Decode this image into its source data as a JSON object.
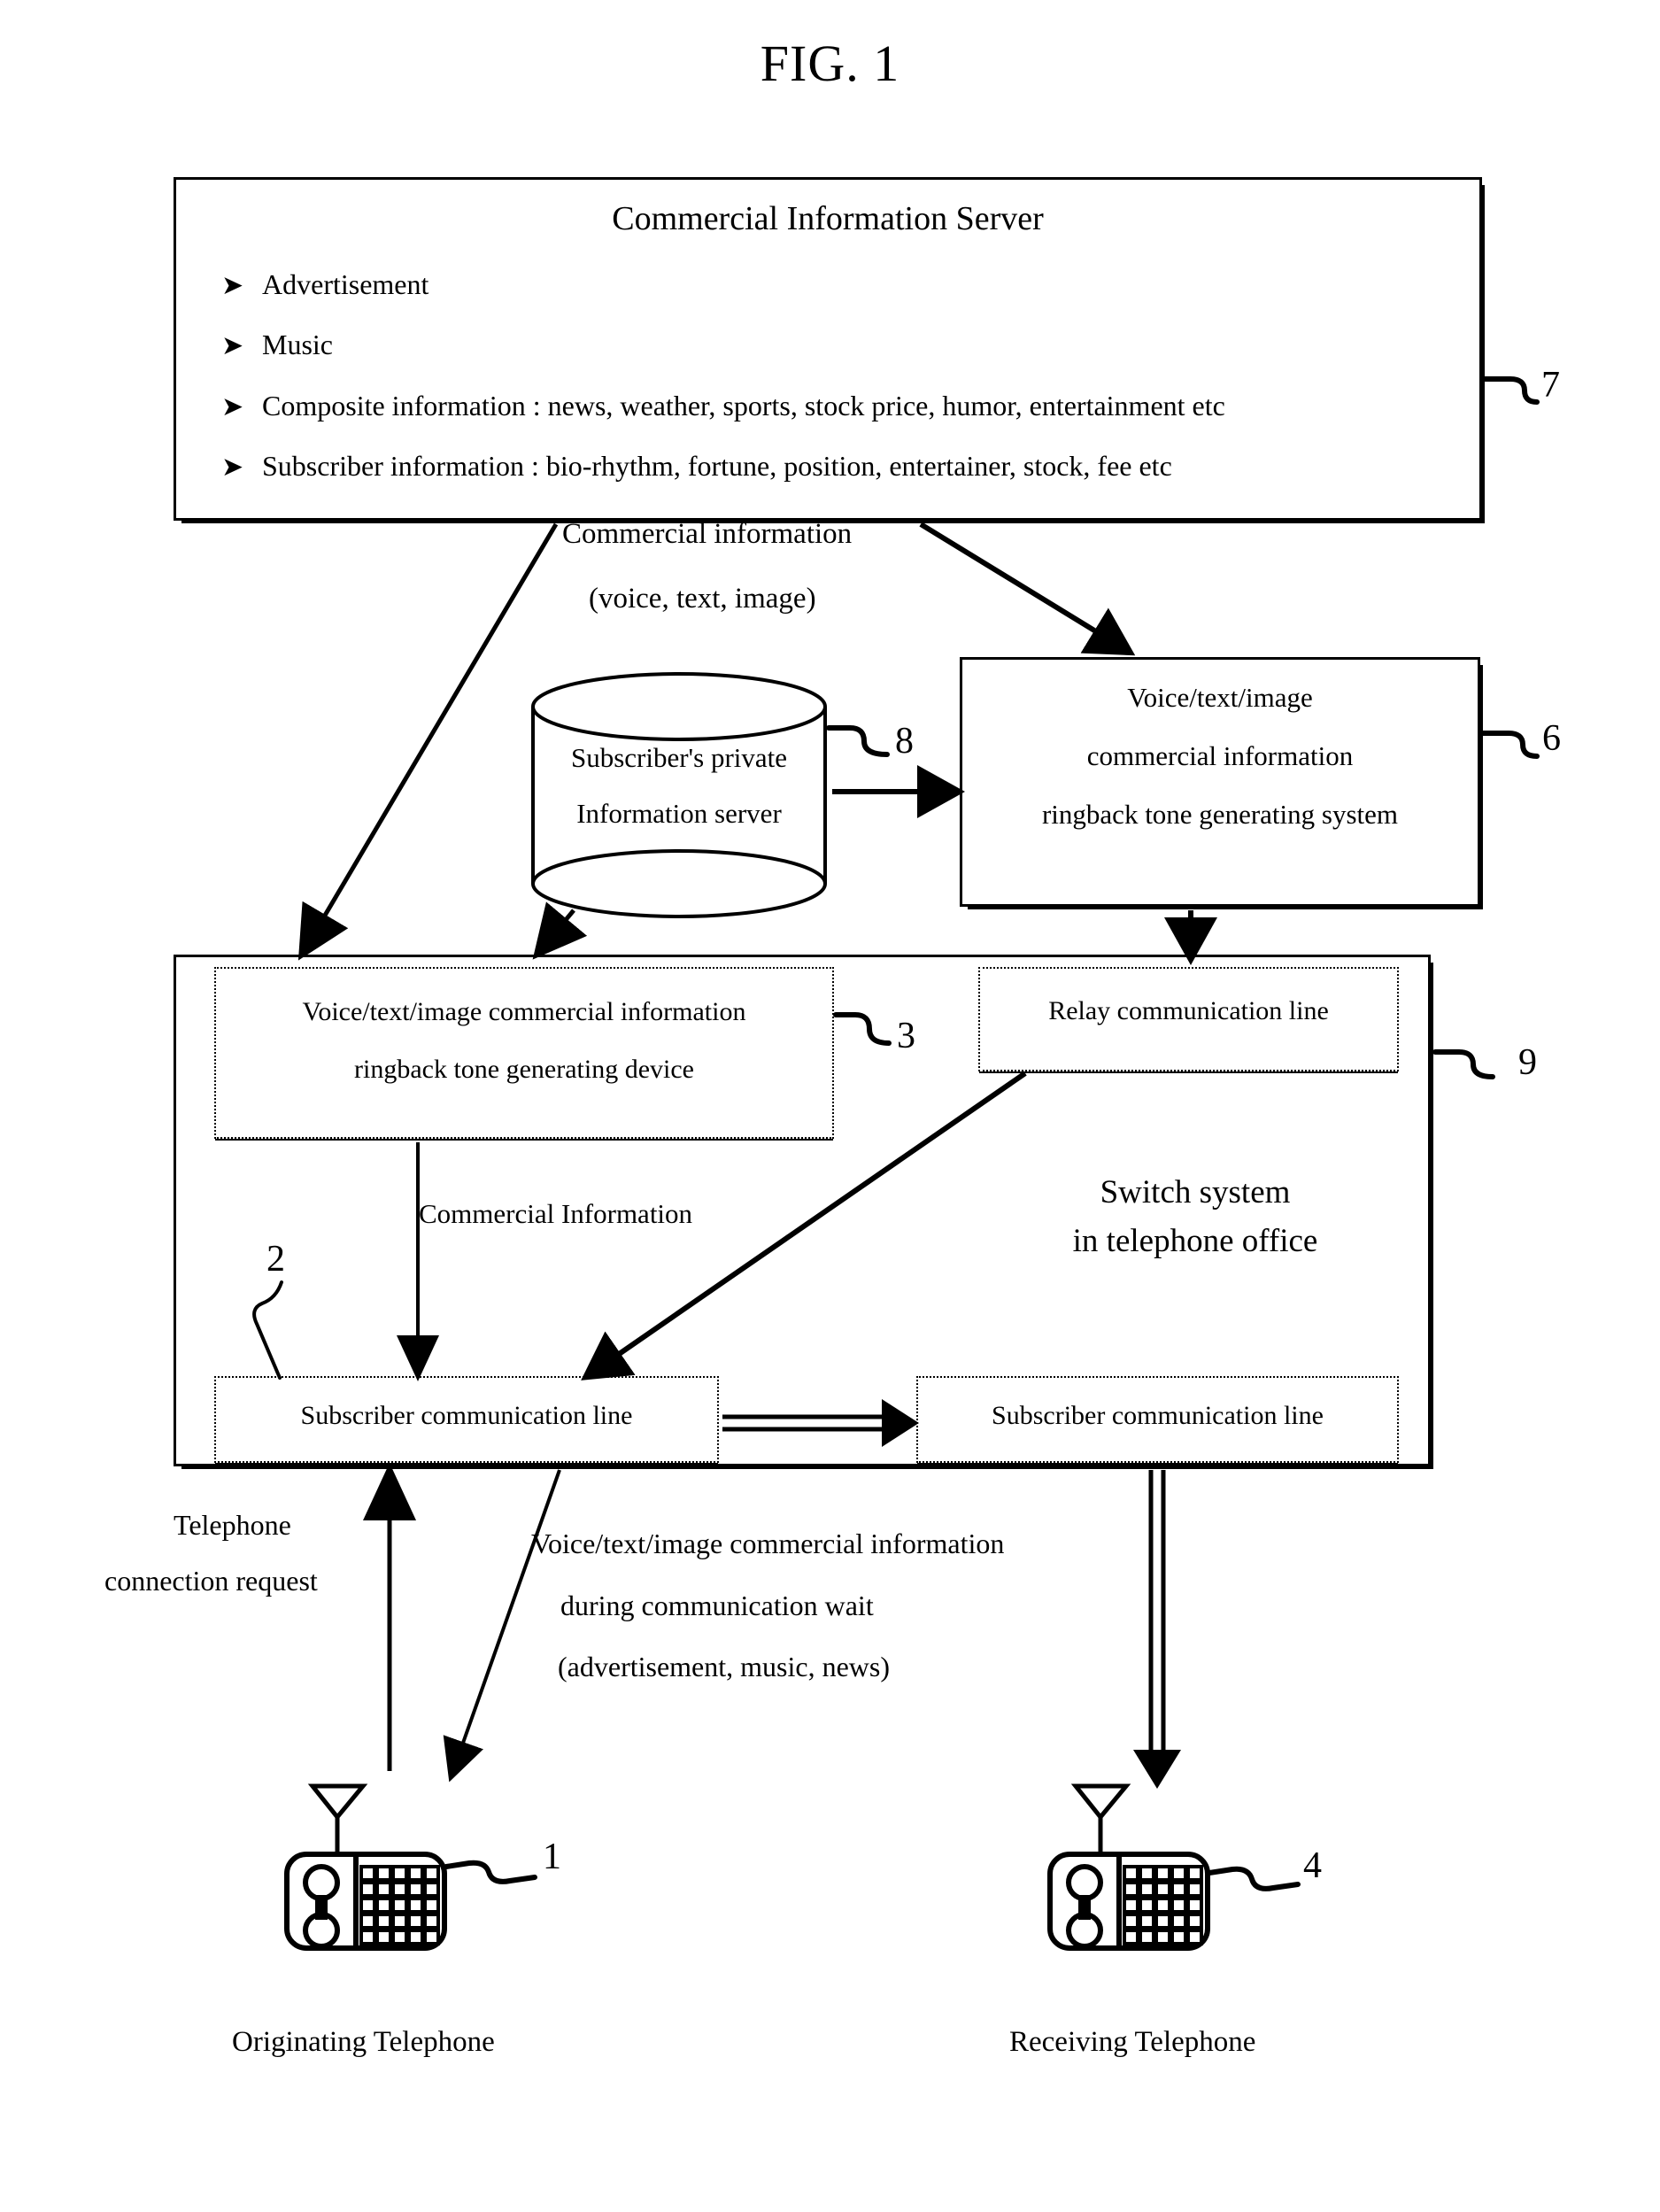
{
  "figure": {
    "title": "FIG. 1"
  },
  "server": {
    "title": "Commercial Information Server",
    "bullet_marker": "➤",
    "items": [
      "Advertisement",
      "Music",
      "Composite information : news, weather, sports, stock price, humor, entertainment etc",
      "Subscriber information : bio-rhythm, fortune, position, entertainer, stock, fee etc"
    ],
    "ref": "7"
  },
  "flow_labels": {
    "commercial_information": "Commercial information",
    "commercial_information_kinds": "(voice, text, image)",
    "commercial_information_mid": "Commercial Information",
    "telephone_connection_request_line1": "Telephone",
    "telephone_connection_request_line2": "connection request",
    "wait_info_line1": "Voice/text/image commercial information",
    "wait_info_line2": "during communication wait",
    "wait_info_line3": "(advertisement, music, news)"
  },
  "private_server": {
    "line1": "Subscriber's private",
    "line2": "Information server",
    "ref": "8"
  },
  "ringback_system": {
    "line1": "Voice/text/image",
    "line2": "commercial information",
    "line3": "ringback tone generating system",
    "ref": "6"
  },
  "switch_system": {
    "title_line1": "Switch system",
    "title_line2": "in telephone office",
    "ref": "9",
    "ringback_device": {
      "line1": "Voice/text/image commercial information",
      "line2": "ringback tone generating device",
      "ref": "3"
    },
    "relay_line": {
      "label": "Relay communication line"
    },
    "subscriber_line_left": {
      "label": "Subscriber communication line",
      "ref": "2"
    },
    "subscriber_line_right": {
      "label": "Subscriber communication line"
    }
  },
  "telephones": {
    "originating": {
      "caption": "Originating Telephone",
      "ref": "1"
    },
    "receiving": {
      "caption": "Receiving Telephone",
      "ref": "4"
    }
  },
  "colors": {
    "ink": "#000000",
    "paper": "#ffffff"
  }
}
